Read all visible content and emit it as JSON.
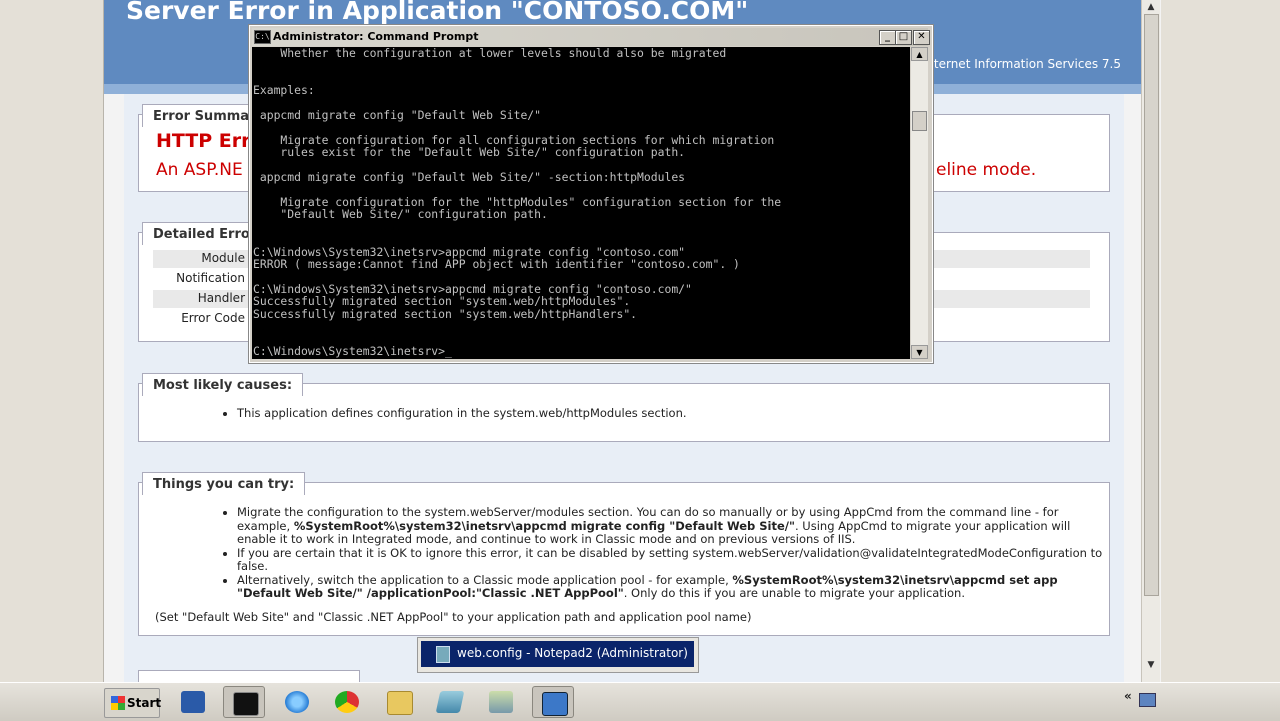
{
  "browser": {
    "page_title": "Server Error in Application \"CONTOSO.COM\"",
    "server_version": "ternet Information Services 7.5"
  },
  "error_summary": {
    "tab": "Error Summar",
    "heading": "HTTP Err",
    "message_left": "An ASP.NE",
    "message_right": "eline mode."
  },
  "detailed_error": {
    "tab": "Detailed Error",
    "labels": [
      "Module",
      "Notification",
      "Handler",
      "Error Code"
    ]
  },
  "causes": {
    "tab": "Most likely causes:",
    "items": [
      "This application defines configuration in the system.web/httpModules section."
    ]
  },
  "try": {
    "tab": "Things you can try:",
    "item1_a": "Migrate the configuration to the system.webServer/modules section. You can do so manually or by using AppCmd from the command line - for example, ",
    "item1_cmd": "%SystemRoot%\\system32\\inetsrv\\appcmd migrate config \"Default Web Site/\"",
    "item1_b": ". Using AppCmd to migrate your application will enable it to work in Integrated mode, and continue to work in Classic mode and on previous versions of IIS.",
    "item2": "If you are certain that it is OK to ignore this error, it can be disabled by setting system.webServer/validation@validateIntegratedModeConfiguration to false.",
    "item3_a": "Alternatively, switch the application to a Classic mode application pool - for example, ",
    "item3_cmd": "%SystemRoot%\\system32\\inetsrv\\appcmd set app \"Default Web Site/\" /applicationPool:\"Classic .NET AppPool\"",
    "item3_b": ". Only do this if you are unable to migrate your application.",
    "note": "(Set \"Default Web Site\" and \"Classic .NET AppPool\" to your application path and application pool name)"
  },
  "cmd": {
    "title": "Administrator: Command Prompt",
    "icon_text": "C:\\",
    "minimize": "_",
    "maximize": "□",
    "close": "✕",
    "lines": [
      "    Whether the configuration at lower levels should also be migrated",
      "",
      "",
      "Examples:",
      "",
      " appcmd migrate config \"Default Web Site/\"",
      "",
      "    Migrate configuration for all configuration sections for which migration",
      "    rules exist for the \"Default Web Site/\" configuration path.",
      "",
      " appcmd migrate config \"Default Web Site/\" -section:httpModules",
      "",
      "    Migrate configuration for the \"httpModules\" configuration section for the",
      "    \"Default Web Site/\" configuration path.",
      "",
      "",
      "C:\\Windows\\System32\\inetsrv>appcmd migrate config \"contoso.com\"",
      "ERROR ( message:Cannot find APP object with identifier \"contoso.com\". )",
      "",
      "C:\\Windows\\System32\\inetsrv>appcmd migrate config \"contoso.com/\"",
      "Successfully migrated section \"system.web/httpModules\".",
      "Successfully migrated section \"system.web/httpHandlers\".",
      "",
      "",
      "C:\\Windows\\System32\\inetsrv>_"
    ]
  },
  "popup": {
    "label": "web.config - Notepad2 (Administrator)"
  },
  "taskbar": {
    "start_label": "Start",
    "tray_arrow": "«"
  }
}
